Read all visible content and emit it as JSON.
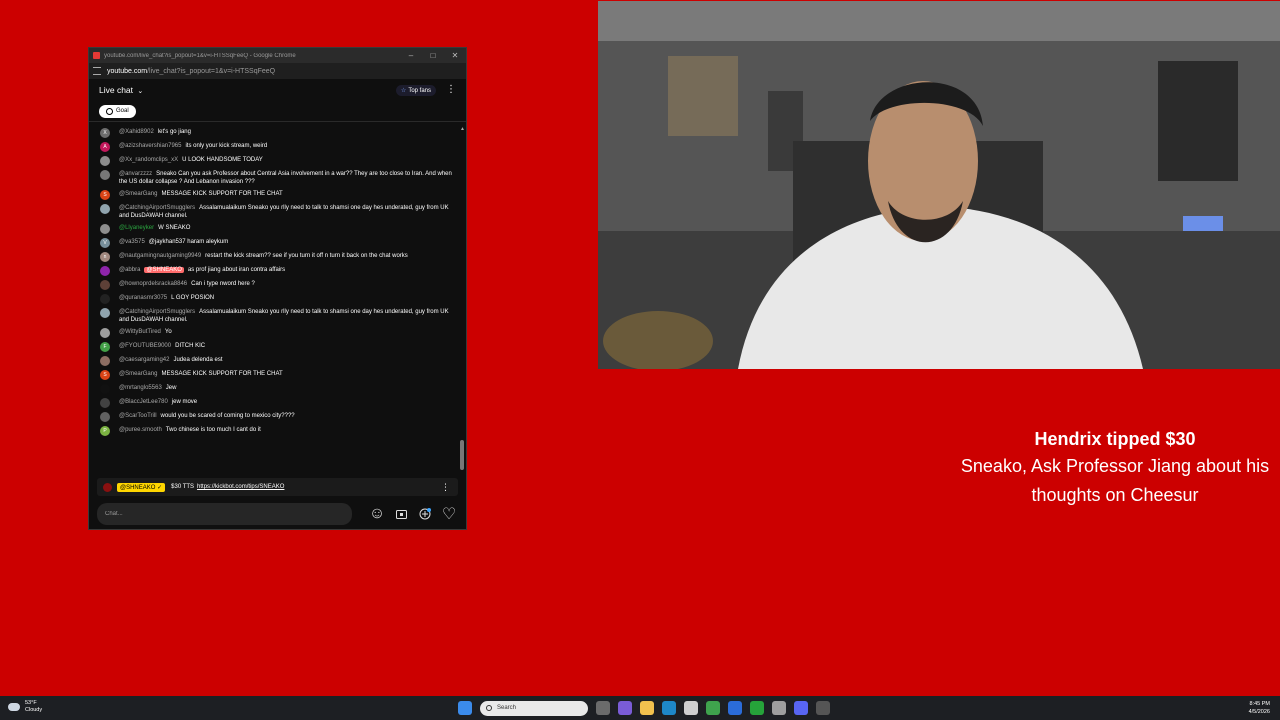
{
  "window": {
    "title": "youtube.com/live_chat?is_popout=1&v=i-HTSSqFeeQ - Google Chrome",
    "url_host": "youtube.com",
    "url_path": "/live_chat?is_popout=1&v=i-HTSSqFeeQ",
    "minimize": "–",
    "maximize": "□",
    "close": "✕"
  },
  "chat": {
    "title": "Live chat",
    "chevron": "⌄",
    "top_fans": "Top fans",
    "menu": "⋮",
    "goal": "Goal",
    "scroll_up": "▲",
    "messages": [
      {
        "author": "@Xahid8902",
        "text": "let's go jiang",
        "color": "#6d6d6d",
        "initial": "X"
      },
      {
        "author": "@azizshavershian7965",
        "text": "its only your kick stream, weird",
        "color": "#c2185b",
        "initial": "A"
      },
      {
        "author": "@Xx_randomclips_xX",
        "text": "U LOOK HANDSOME TODAY",
        "color": "#8d8d8d",
        "initial": ""
      },
      {
        "author": "@anvarzzzz",
        "text": "Sneako Can you ask Professor about Central Asia involvement in a war?? They are too close to Iran. And when the US dollar collapse ? And Lebanon invasion ???",
        "color": "#777777",
        "initial": ""
      },
      {
        "author": "@SmearGang",
        "text": "MESSAGE KICK SUPPORT FOR THE CHAT",
        "color": "#d84315",
        "initial": "S"
      },
      {
        "author": "@CatchingAirportSmugglers",
        "text": "Assalamualaikum Sneako you rlly need to talk to shamsi one day hes underated, guy from UK and DusDAWAH channel.",
        "color": "#90a4ae",
        "initial": ""
      },
      {
        "author": "@Llyaneyker",
        "text": "W SNEAKO",
        "color": "#8e8e8e",
        "initial": "",
        "green": true
      },
      {
        "author": "@va3575",
        "text": "@jaykhan537 haram aleykum",
        "color": "#78909c",
        "initial": "V"
      },
      {
        "author": "@nautgamingnautgaming9949",
        "text": "restart the kick stream?? see if you turn it off n turn it back on the chat works",
        "color": "#a1887f",
        "initial": "n"
      },
      {
        "author": "@abbra",
        "text": "as prof jiang about iran contra affairs",
        "color": "#8e24aa",
        "initial": "",
        "mention": "@SHNEAKO"
      },
      {
        "author": "@hownoprdelsracka8846",
        "text": "Can i type nword here ?",
        "color": "#5d4037",
        "initial": ""
      },
      {
        "author": "@quranasmr3075",
        "text": "L GOY POSION",
        "color": "#222222",
        "initial": ""
      },
      {
        "author": "@CatchingAirportSmugglers",
        "text": "Assalamualaikum Sneako you rlly need to talk to shamsi one day hes underated, guy from UK and DusDAWAH channel.",
        "color": "#90a4ae",
        "initial": ""
      },
      {
        "author": "@WittyButTired",
        "text": "Yo",
        "color": "#9e9e9e",
        "initial": ""
      },
      {
        "author": "@FYOUTUBE9000",
        "text": "DITCH KIC",
        "color": "#43a047",
        "initial": "F"
      },
      {
        "author": "@caesargaming42",
        "text": "Judea delenda est",
        "color": "#8d6e63",
        "initial": ""
      },
      {
        "author": "@SmearGang",
        "text": "MESSAGE KICK SUPPORT FOR THE CHAT",
        "color": "#d84315",
        "initial": "S"
      },
      {
        "author": "@mrtanglo5563",
        "text": "Jew",
        "color": "#111111",
        "initial": ""
      },
      {
        "author": "@BlaccJetLee780",
        "text": "jew move",
        "color": "#424242",
        "initial": ""
      },
      {
        "author": "@ScarTooTrill",
        "text": "would you be scared of coming to mexico city????",
        "color": "#616161",
        "initial": ""
      },
      {
        "author": "@puree.smooth",
        "text": "Two chinese is too much I cant do it",
        "color": "#7cb342",
        "initial": "P"
      }
    ],
    "pinned": {
      "author": "@SHNEAKO ✓",
      "text": "$30 TTS",
      "link": "https://kickbot.com/tips/SNEAKO",
      "menu": "⋮"
    },
    "input_placeholder": "Chat...",
    "emoji_icon": "☺",
    "heart_icon": "♡"
  },
  "tip": {
    "title": "Hendrix tipped $30",
    "body": "Sneako, Ask Professor Jiang about his thoughts on Cheesur"
  },
  "taskbar": {
    "temp": "53°F",
    "condition": "Cloudy",
    "search_placeholder": "Search",
    "time": "8:45 PM",
    "date": "4/5/2026"
  },
  "colors": {
    "background": "#cc0000",
    "chat_bg": "#0f0f0f",
    "mention": "#ff6b6b",
    "pinned_badge": "#ffd600"
  }
}
